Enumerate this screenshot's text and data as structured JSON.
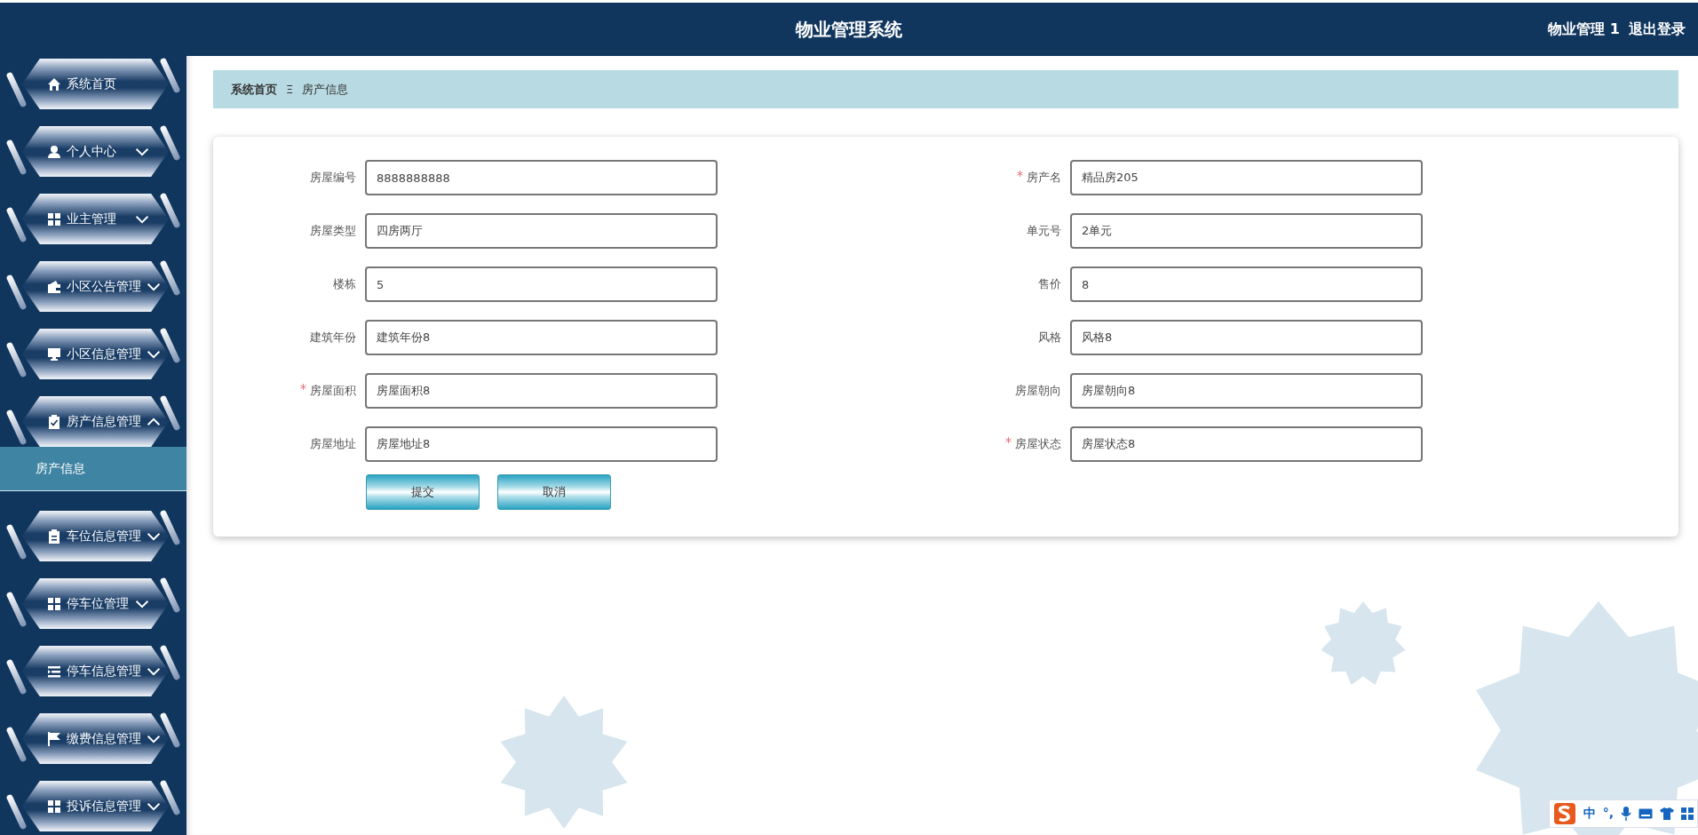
{
  "header": {
    "title": "物业管理系统",
    "user": "物业管理 1",
    "logout": "退出登录"
  },
  "sidebar": {
    "items": [
      {
        "label": "系统首页",
        "kind": "home"
      },
      {
        "label": "个人中心",
        "kind": "user",
        "expanded": false
      },
      {
        "label": "业主管理",
        "kind": "grid",
        "expanded": false
      },
      {
        "label": "小区公告管理",
        "kind": "wallet",
        "expanded": false
      },
      {
        "label": "小区信息管理",
        "kind": "monitor",
        "expanded": false
      },
      {
        "label": "房产信息管理",
        "kind": "clipboard-check",
        "expanded": true,
        "children": [
          {
            "label": "房产信息",
            "selected": true
          }
        ]
      },
      {
        "label": "车位信息管理",
        "kind": "clipboard",
        "expanded": false
      },
      {
        "label": "停车位管理",
        "kind": "grid",
        "expanded": false
      },
      {
        "label": "停车信息管理",
        "kind": "list",
        "expanded": false
      },
      {
        "label": "缴费信息管理",
        "kind": "flag",
        "expanded": false
      },
      {
        "label": "投诉信息管理",
        "kind": "grid",
        "expanded": false
      }
    ]
  },
  "breadcrumb": {
    "items": [
      "系统首页",
      "房产信息"
    ],
    "separator": "Ξ"
  },
  "form": {
    "fields": [
      {
        "label": "房屋编号",
        "value": "8888888888",
        "required": false
      },
      {
        "label": "房产名",
        "value": "精品房205",
        "required": true
      },
      {
        "label": "房屋类型",
        "value": "四房两厅",
        "required": false
      },
      {
        "label": "单元号",
        "value": "2单元",
        "required": false
      },
      {
        "label": "楼栋",
        "value": "5",
        "required": false
      },
      {
        "label": "售价",
        "value": "8",
        "required": false
      },
      {
        "label": "建筑年份",
        "value": "建筑年份8",
        "required": false
      },
      {
        "label": "风格",
        "value": "风格8",
        "required": false
      },
      {
        "label": "房屋面积",
        "value": "房屋面积8",
        "required": true
      },
      {
        "label": "房屋朝向",
        "value": "房屋朝向8",
        "required": false
      },
      {
        "label": "房屋地址",
        "value": "房屋地址8",
        "required": false
      },
      {
        "label": "房屋状态",
        "value": "房屋状态8",
        "required": true
      }
    ],
    "buttons": [
      "提交",
      "取消"
    ]
  },
  "ime_toolbar": {
    "items": [
      "中",
      "°,"
    ]
  }
}
